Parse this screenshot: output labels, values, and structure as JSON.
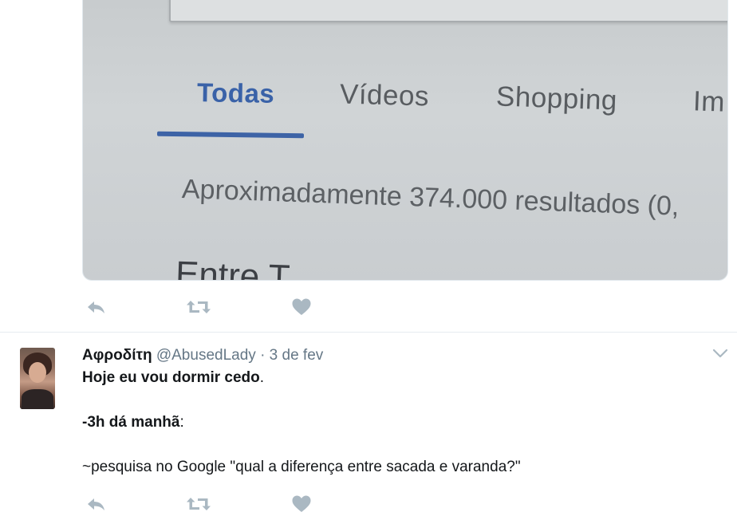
{
  "media": {
    "tabs": [
      {
        "label": "Todas",
        "active": true
      },
      {
        "label": "Vídeos",
        "active": false
      },
      {
        "label": "Shopping",
        "active": false
      },
      {
        "label": "Im",
        "active": false
      }
    ],
    "results_text": "Aproximadamente 374.000 resultados (0,",
    "next_line_text": "Entre T...",
    "accent_color": "#3d63a6"
  },
  "tweet1_actions": {
    "icons": [
      "reply-icon",
      "retweet-icon",
      "like-heart-icon"
    ],
    "icon_color": "#aab8c2"
  },
  "tweet2": {
    "display_name": "Αφροδίτη",
    "handle": "@AbusedLady",
    "separator": "·",
    "time": "3 de fev",
    "lines": [
      {
        "bold": "Hoje eu vou dormir cedo",
        "rest": "."
      },
      {
        "bold": "-3h dá manhã",
        "rest": ":"
      },
      {
        "bold": "",
        "rest": "~pesquisa no Google \"qual a diferença entre sacada e varanda?\""
      }
    ],
    "menu_icon": "chevron-down-icon"
  }
}
